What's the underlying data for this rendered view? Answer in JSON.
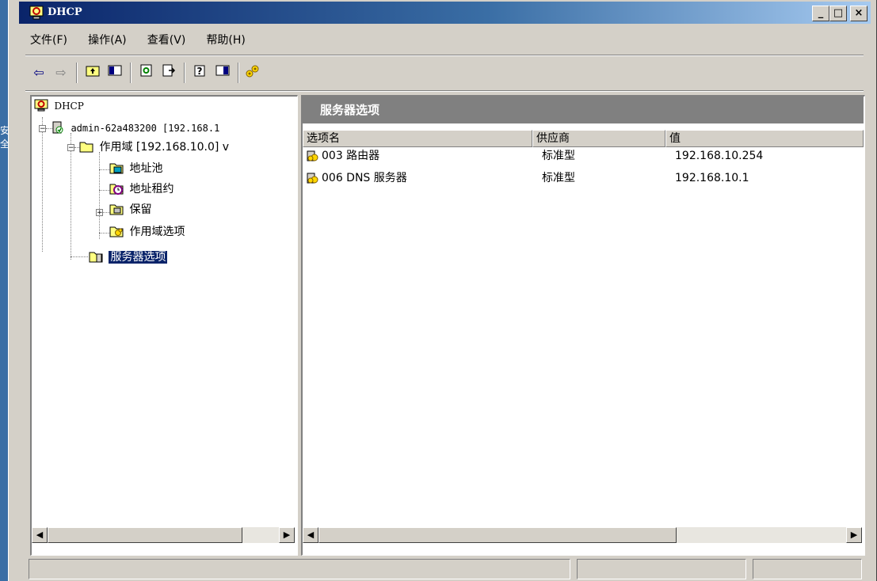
{
  "desktop": {
    "side_text": "安全"
  },
  "window": {
    "title": "DHCP",
    "controls": {
      "minimize": "_",
      "maximize": "□",
      "close": "×"
    }
  },
  "menu": [
    {
      "label": "文件(F)"
    },
    {
      "label": "操作(A)"
    },
    {
      "label": "查看(V)"
    },
    {
      "label": "帮助(H)"
    }
  ],
  "toolbar": {
    "buttons": [
      "back-icon",
      "forward-icon",
      "up-folder-icon",
      "show-tree-icon",
      "properties-icon",
      "export-icon",
      "help-icon",
      "console-icon",
      "wizard-icon"
    ]
  },
  "tree": {
    "root": "DHCP",
    "server": "admin-62a483200 [192.168.1",
    "scope": "作用域 [192.168.10.0] v",
    "address_pool": "地址池",
    "leases": "地址租约",
    "reservations": "保留",
    "scope_options": "作用域选项",
    "server_options": "服务器选项"
  },
  "details": {
    "header": "服务器选项",
    "columns": [
      "选项名",
      "供应商",
      "值"
    ],
    "rows": [
      {
        "name": "003 路由器",
        "vendor": "标准型",
        "value": "192.168.10.254"
      },
      {
        "name": "006 DNS 服务器",
        "vendor": "标准型",
        "value": "192.168.10.1"
      }
    ]
  },
  "colors": {
    "titlebar_start": "#0a246a",
    "titlebar_end": "#a6caf0",
    "selection": "#0a246a",
    "chrome": "#d4d0c8"
  }
}
